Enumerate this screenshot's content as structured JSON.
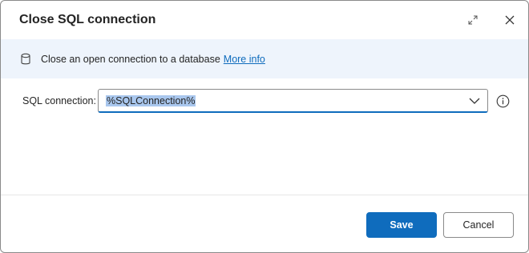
{
  "dialog": {
    "title": "Close SQL connection",
    "expand_icon": "expand-icon",
    "close_icon": "close-icon"
  },
  "info_bar": {
    "icon": "database-icon",
    "text": "Close an open connection to a database",
    "link": "More info"
  },
  "form": {
    "sql_connection_label": "SQL connection:",
    "sql_connection_value": "%SQLConnection%",
    "dropdown_icon": "chevron-down-icon",
    "help_icon": "info-icon"
  },
  "footer": {
    "save_label": "Save",
    "cancel_label": "Cancel"
  },
  "colors": {
    "accent": "#0f6cbd",
    "info_bar_bg": "#eef4fc",
    "selection": "#a9c7ee"
  }
}
